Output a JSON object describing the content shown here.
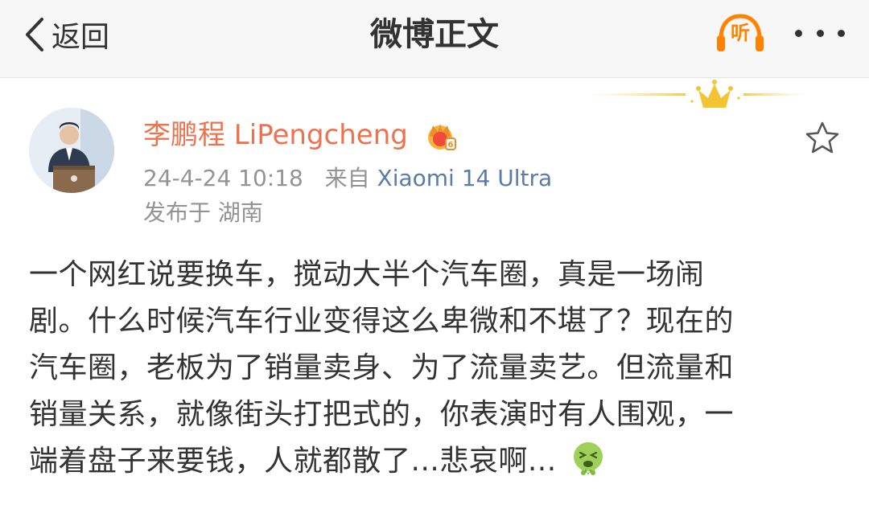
{
  "header": {
    "back_label": "返回",
    "title": "微博正文",
    "listen_label": "听",
    "accent_color": "#ff8200"
  },
  "post": {
    "author": "李鹏程 LiPengcheng",
    "author_color": "#eb7350",
    "timestamp": "24-4-24 10:18",
    "source_prefix": "来自",
    "source": "Xiaomi 14 Ultra",
    "location": "发布于 湖南",
    "lines": [
      "一个网红说要换车，搅动大半个汽车圈，真是一场闹",
      "剧。什么时候汽车行业变得这么卑微和不堪了？现在的",
      "汽车圈，老板为了销量卖身、为了流量卖艺。但流量和",
      "销量关系，就像街头打把式的，你表演时有人围观，一",
      "端着盘子来要钱，人就都散了...悲哀啊..."
    ],
    "emoji": "vomit-emoji"
  },
  "icons": {
    "back": "chevron-left-icon",
    "listen": "headphones-icon",
    "more": "more-dots-icon",
    "favorite": "star-icon",
    "vip": "crown-badge-icon",
    "decoration": "crown-icon"
  }
}
